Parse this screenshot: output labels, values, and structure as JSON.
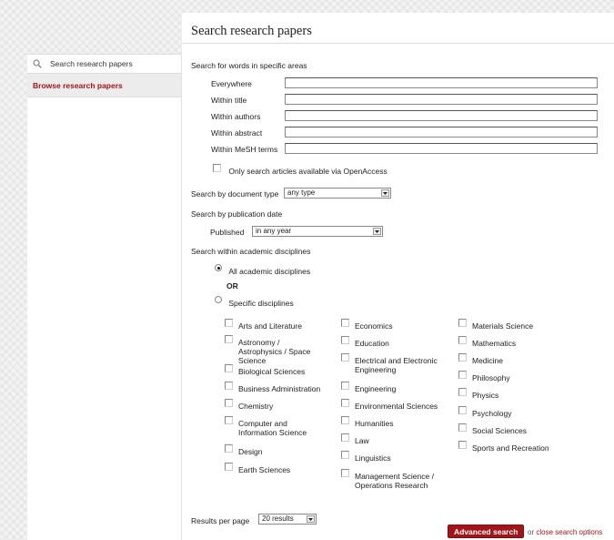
{
  "sidebar": {
    "search_label": "Search research papers",
    "browse_label": "Browse research papers"
  },
  "main": {
    "title": "Search research papers",
    "areas_heading": "Search for words in specific areas",
    "fields": [
      {
        "label": "Everywhere",
        "value": ""
      },
      {
        "label": "Within title",
        "value": ""
      },
      {
        "label": "Within authors",
        "value": ""
      },
      {
        "label": "Within abstract",
        "value": ""
      },
      {
        "label": "Within MeSH terms",
        "value": ""
      }
    ],
    "openaccess_label": "Only search articles available via OpenAccess",
    "doctype_label": "Search by document type",
    "doctype_value": "any type",
    "pubdate_heading": "Search by publication date",
    "published_label": "Published",
    "published_value": "in any year",
    "disciplines_heading": "Search within academic disciplines",
    "all_disciplines_label": "All academic disciplines",
    "or_label": "OR",
    "specific_label": "Specific disciplines",
    "disciplines": [
      "Arts and Literature",
      "Astronomy / Astrophysics / Space Science",
      "Biological Sciences",
      "Business Administration",
      "Chemistry",
      "Computer and Information Science",
      "Design",
      "Earth Sciences",
      "Economics",
      "Education",
      "Electrical and Electronic Engineering",
      "Engineering",
      "Environmental Sciences",
      "Humanities",
      "Law",
      "Linguistics",
      "Management Science / Operations Research",
      "Materials Science",
      "Mathematics",
      "Medicine",
      "Philosophy",
      "Physics",
      "Psychology",
      "Social Sciences",
      "Sports and Recreation"
    ],
    "results_label": "Results per page",
    "results_value": "20 results",
    "advanced_button": "Advanced search",
    "or_text": "or",
    "close_link": "close search options"
  },
  "colors": {
    "accent": "#a3141a"
  }
}
